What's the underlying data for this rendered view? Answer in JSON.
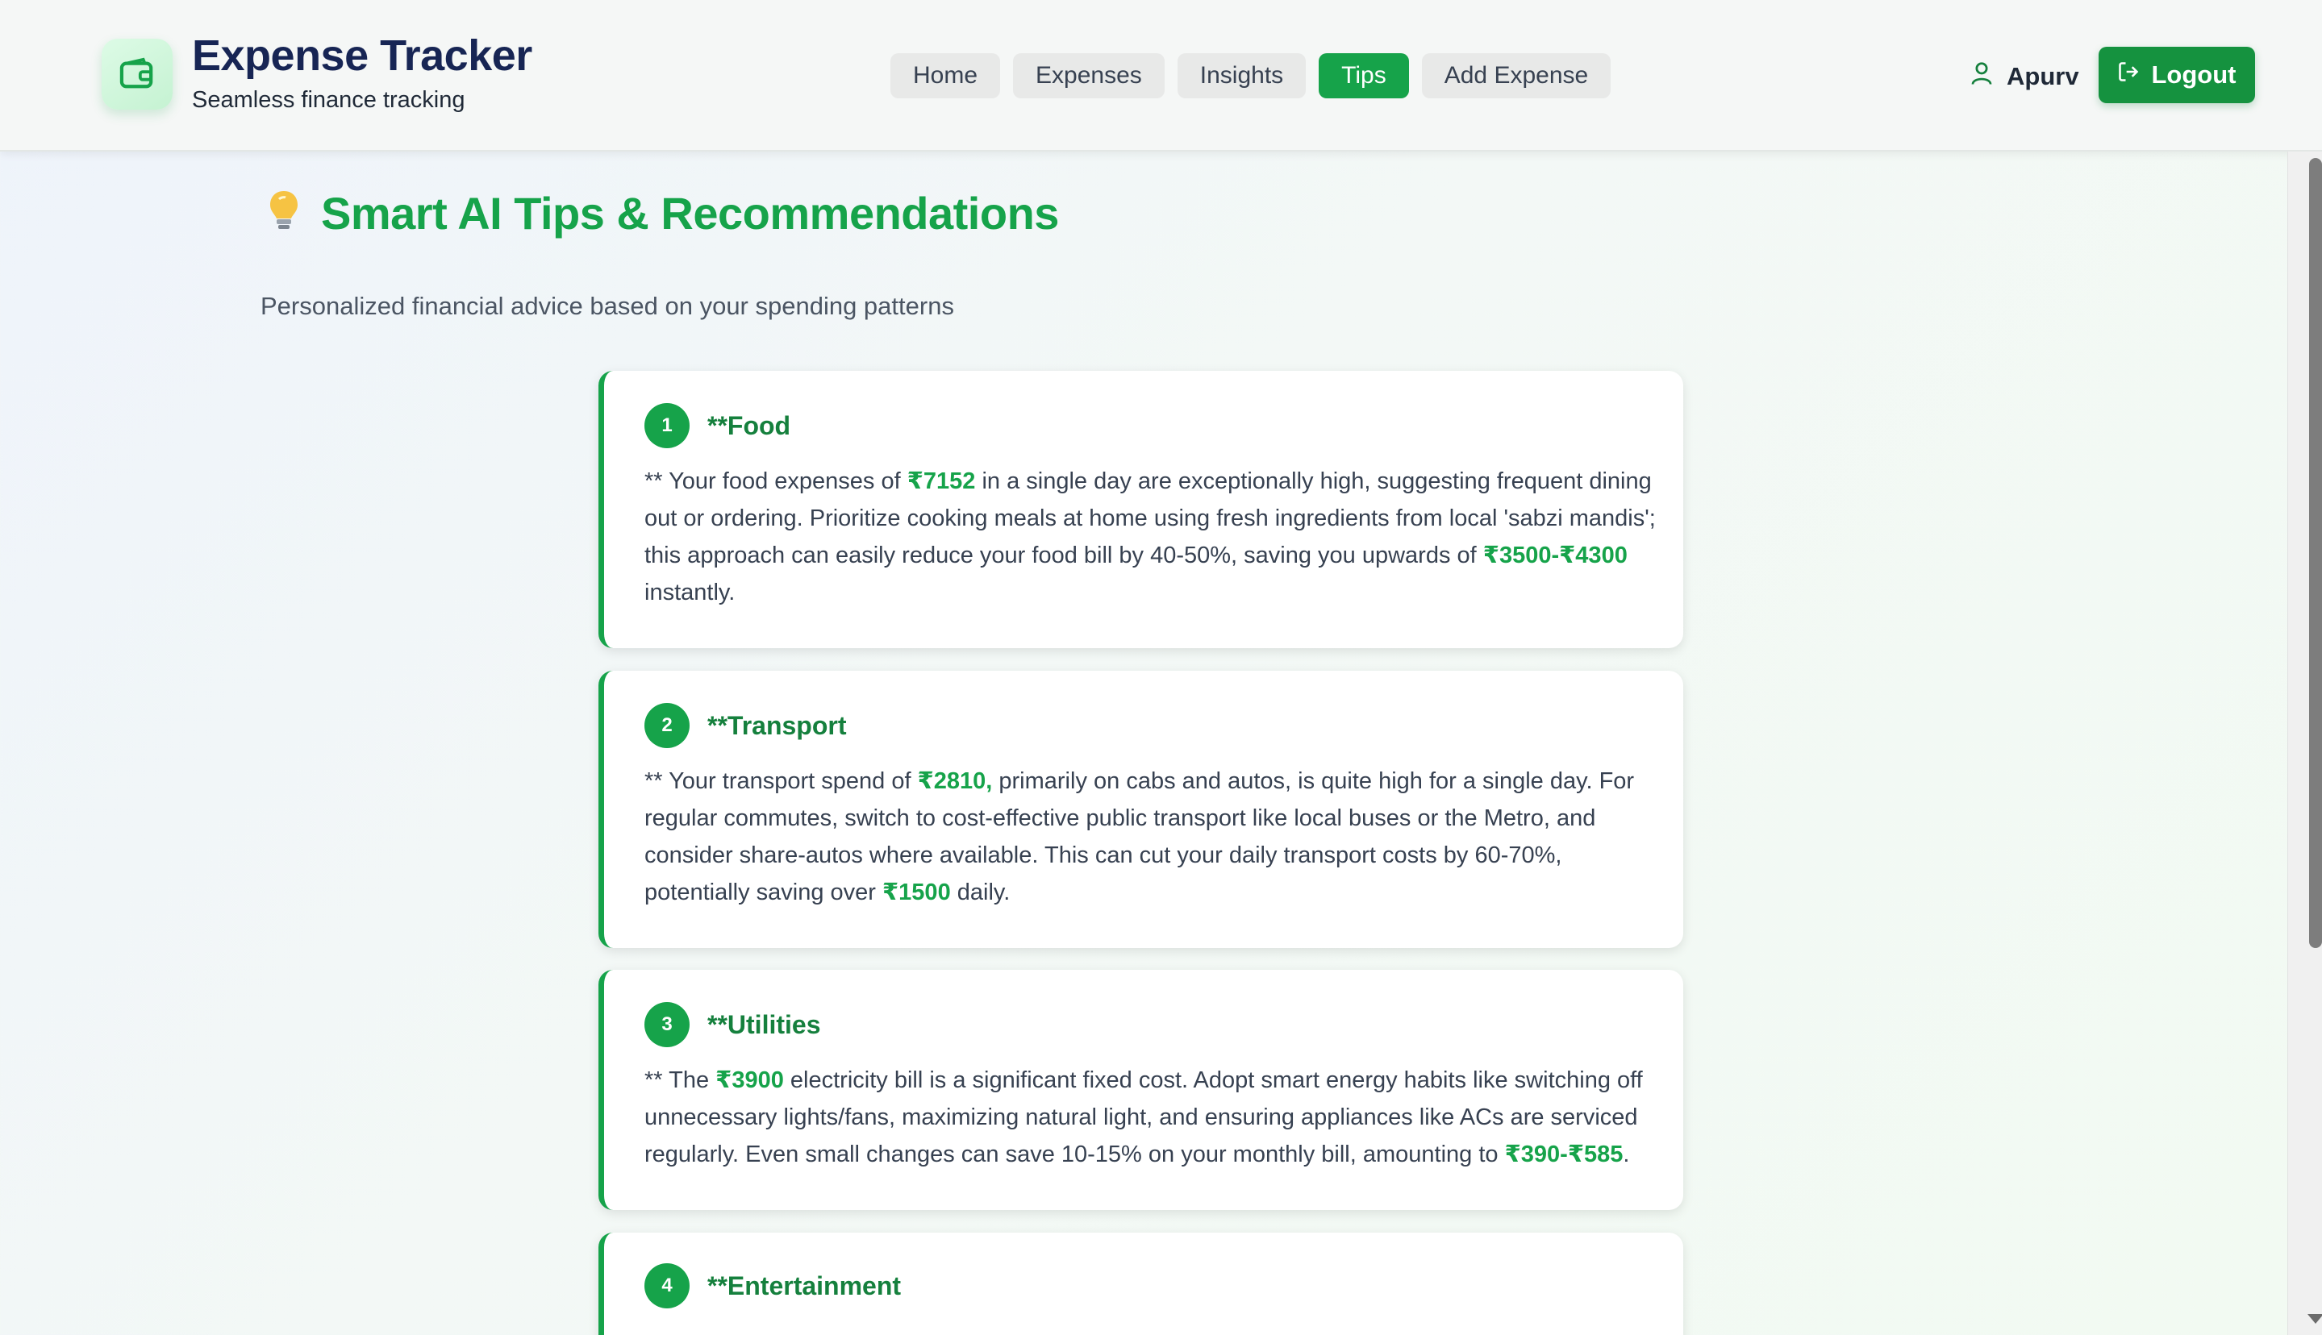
{
  "header": {
    "title": "Expense Tracker",
    "subtitle": "Seamless finance tracking",
    "nav": [
      "Home",
      "Expenses",
      "Insights",
      "Tips",
      "Add Expense"
    ],
    "active_nav": "Tips",
    "user_name": "Apurv",
    "logout_label": "Logout"
  },
  "page": {
    "title": "Smart AI Tips & Recommendations",
    "subtitle": "Personalized financial advice based on your spending patterns"
  },
  "tips": [
    {
      "number": "1",
      "title": "**Food",
      "segments": [
        {
          "t": "** Your food expenses of "
        },
        {
          "t": "₹7152",
          "hl": true
        },
        {
          "t": " in a single day are exceptionally high, suggesting frequent dining out or ordering. Prioritize cooking meals at home using fresh ingredients from local 'sabzi mandis'; this approach can easily reduce your food bill by 40-50%, saving you upwards of "
        },
        {
          "t": "₹3500-₹4300",
          "hl": true
        },
        {
          "t": " instantly."
        }
      ]
    },
    {
      "number": "2",
      "title": "**Transport",
      "segments": [
        {
          "t": "** Your transport spend of "
        },
        {
          "t": "₹2810,",
          "hl": true
        },
        {
          "t": " primarily on cabs and autos, is quite high for a single day. For regular commutes, switch to cost-effective public transport like local buses or the Metro, and consider share-autos where available. This can cut your daily transport costs by 60-70%, potentially saving over "
        },
        {
          "t": "₹1500",
          "hl": true
        },
        {
          "t": " daily."
        }
      ]
    },
    {
      "number": "3",
      "title": "**Utilities",
      "segments": [
        {
          "t": "** The "
        },
        {
          "t": "₹3900",
          "hl": true
        },
        {
          "t": " electricity bill is a significant fixed cost. Adopt smart energy habits like switching off unnecessary lights/fans, maximizing natural light, and ensuring appliances like ACs are serviced regularly. Even small changes can save 10-15% on your monthly bill, amounting to "
        },
        {
          "t": "₹390-₹585",
          "hl": true
        },
        {
          "t": "."
        }
      ]
    },
    {
      "number": "4",
      "title": "**Entertainment",
      "segments": []
    }
  ]
}
